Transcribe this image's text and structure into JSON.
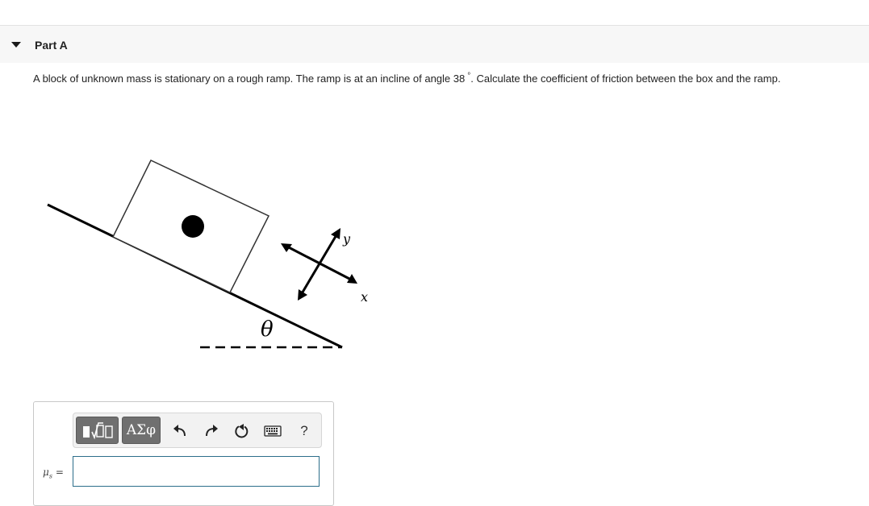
{
  "part": {
    "title": "Part A"
  },
  "question": {
    "text_before": "A block of unknown mass is stationary on a rough ramp. The ramp is at an incline of angle 38",
    "degree_symbol": "°",
    "text_after": ".  Calculate the coefficient of friction between the box and the ramp."
  },
  "figure": {
    "angle_label": "θ",
    "axis_y_label": "y",
    "axis_x_label": "x"
  },
  "toolbar": {
    "symbols_label": "ΑΣφ",
    "help_label": "?",
    "icons": [
      "templates-icon",
      "undo-icon",
      "redo-icon",
      "reset-icon",
      "keyboard-icon",
      "help-icon"
    ]
  },
  "answer": {
    "label_symbol": "μ",
    "label_subscript": "s",
    "label_equals": "=",
    "value": "",
    "placeholder": ""
  },
  "colors": {
    "input_border": "#2c6e8a",
    "button_bg": "#707070"
  }
}
